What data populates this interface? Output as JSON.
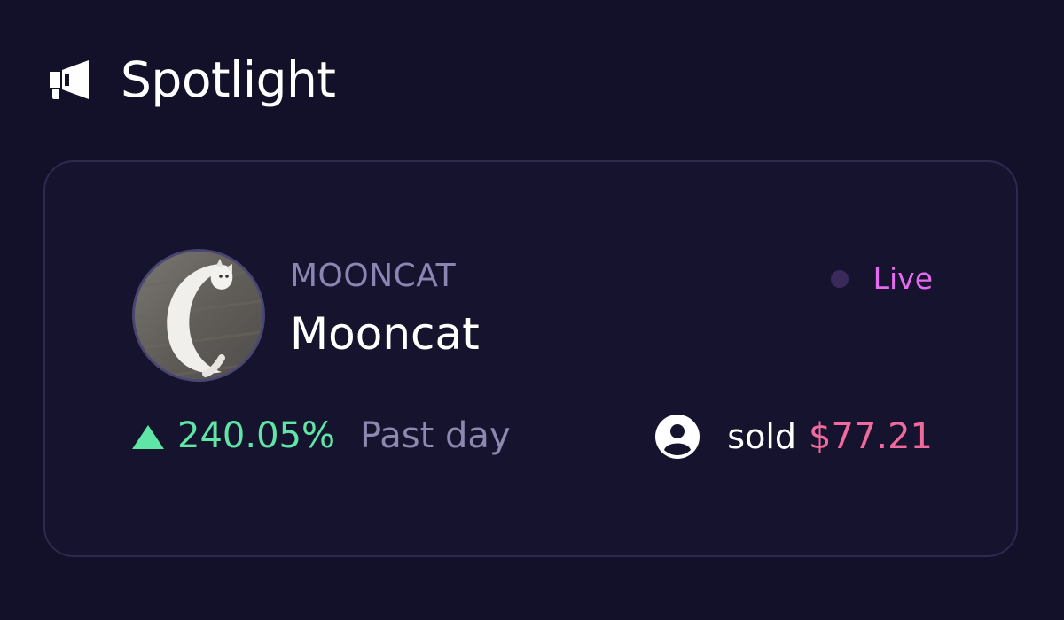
{
  "header": {
    "title": "Spotlight",
    "icon": "megaphone-icon"
  },
  "spotlight": {
    "ticker": "MOONCAT",
    "name": "Mooncat",
    "status_label": "Live",
    "change": {
      "value": "240.05%",
      "direction": "up",
      "period": "Past day"
    },
    "sold": {
      "label": "sold",
      "value": "$77.21"
    },
    "avatar_icon": "cat-avatar-image",
    "user_icon": "user-circle-icon"
  },
  "colors": {
    "background": "#13112a",
    "card_border": "#2d2a4e",
    "ticker": "#8a86b4",
    "live": "#e46bf0",
    "positive": "#5fe6a6",
    "sold_value": "#f06a9e"
  }
}
